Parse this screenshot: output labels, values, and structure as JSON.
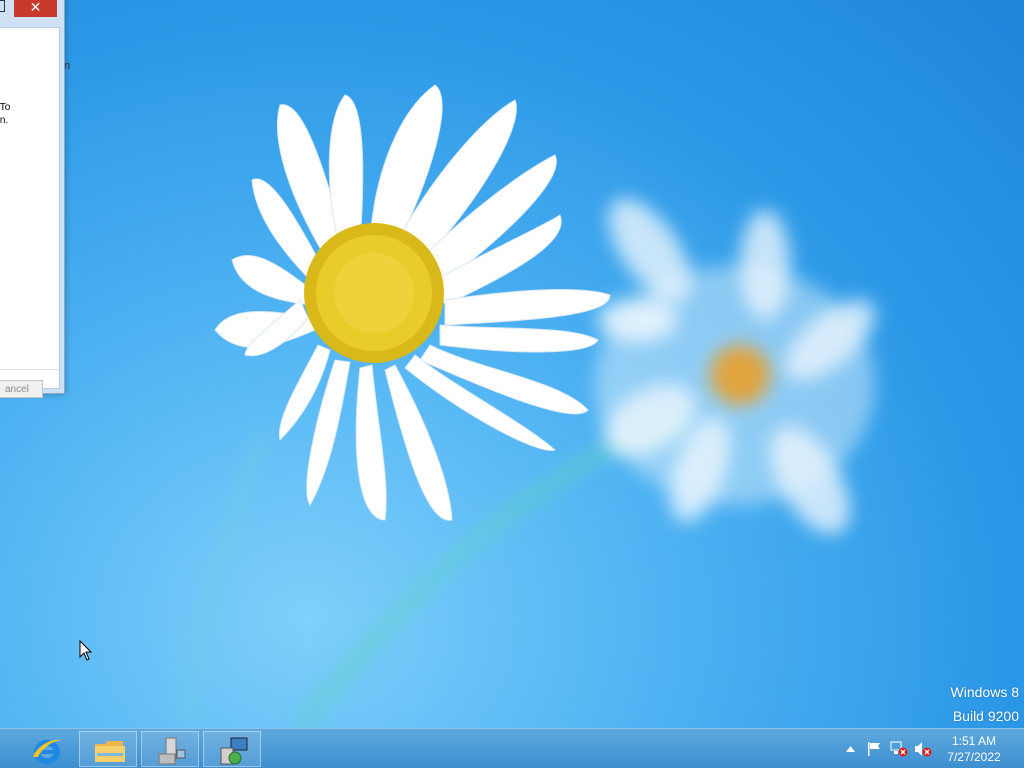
{
  "dialog": {
    "close_symbol": "✕",
    "text_lines": "y\nied. To\nagain.",
    "cancel_label": "ancel",
    "stray_char": "n"
  },
  "watermark": {
    "line1": "Windows 8",
    "line2": "Build 9200"
  },
  "taskbar": {
    "apps": [
      {
        "name": "internet-explorer",
        "icon": "ie-icon"
      },
      {
        "name": "file-explorer",
        "icon": "folder-icon"
      },
      {
        "name": "server-manager",
        "icon": "server-manager-icon"
      },
      {
        "name": "network-setup",
        "icon": "network-computer-icon"
      }
    ]
  },
  "tray": {
    "icons": [
      "show-hidden-icons-arrow",
      "action-center-flag-icon",
      "network-disconnected-icon",
      "volume-muted-icon"
    ],
    "time": "1:51 AM",
    "date": "7/27/2022"
  },
  "colors": {
    "sky": "#2a97e6",
    "taskbar": "#4a9ad8",
    "close_button": "#c7392a",
    "daisy_center": "#e0c21d"
  }
}
